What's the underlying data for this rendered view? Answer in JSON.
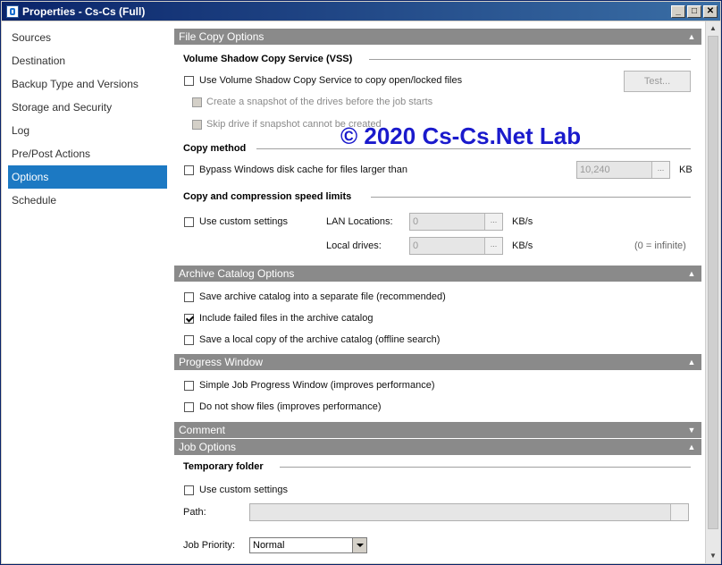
{
  "window": {
    "title": "Properties - Cs-Cs (Full)",
    "buttons": {
      "minimize": "_",
      "maximize": "□",
      "close": "✕"
    }
  },
  "sidebar": {
    "items": [
      {
        "label": "Sources"
      },
      {
        "label": "Destination"
      },
      {
        "label": "Backup Type and Versions"
      },
      {
        "label": "Storage and Security"
      },
      {
        "label": "Log"
      },
      {
        "label": "Pre/Post Actions"
      },
      {
        "label": "Options",
        "active": true
      },
      {
        "label": "Schedule"
      }
    ]
  },
  "file_copy": {
    "header": "File Copy Options",
    "vss": {
      "title": "Volume Shadow Copy Service (VSS)",
      "use_vss": {
        "label": "Use Volume Shadow Copy Service to copy open/locked files",
        "checked": false
      },
      "test_button": "Test...",
      "snapshot": {
        "label": "Create a snapshot of the drives before the job starts",
        "checked": false,
        "disabled": true
      },
      "skip_drive": {
        "label": "Skip drive if snapshot cannot be created",
        "checked": false,
        "disabled": true
      }
    },
    "copy_method": {
      "title": "Copy method",
      "bypass": {
        "label": "Bypass Windows disk cache for files larger than",
        "checked": false
      },
      "size_value": "10,240",
      "size_unit": "KB"
    },
    "speed": {
      "title": "Copy and compression speed limits",
      "custom": {
        "label": "Use custom settings",
        "checked": false
      },
      "lan_label": "LAN Locations:",
      "lan_value": "0",
      "lan_unit": "KB/s",
      "local_label": "Local drives:",
      "local_value": "0",
      "local_unit": "KB/s",
      "hint": "(0 = infinite)"
    }
  },
  "archive": {
    "header": "Archive Catalog Options",
    "separate": {
      "label": "Save archive catalog into a separate file (recommended)",
      "checked": false
    },
    "include_failed": {
      "label": "Include failed files in the archive catalog",
      "checked": true
    },
    "local_copy": {
      "label": "Save a local copy of the archive catalog (offline search)",
      "checked": false
    }
  },
  "progress": {
    "header": "Progress Window",
    "simple": {
      "label": "Simple Job Progress Window (improves performance)",
      "checked": false
    },
    "no_files": {
      "label": "Do not show files (improves performance)",
      "checked": false
    }
  },
  "comment": {
    "header": "Comment"
  },
  "job_options": {
    "header": "Job Options",
    "temp_title": "Temporary folder",
    "custom": {
      "label": "Use custom settings",
      "checked": false
    },
    "path_label": "Path:",
    "path_value": "",
    "priority_label": "Job Priority:",
    "priority_value": "Normal"
  },
  "watermark": "© 2020 Cs-Cs.Net Lab",
  "icons": {
    "collapse": "chevron-up-icon",
    "expand": "chevron-down-icon"
  }
}
